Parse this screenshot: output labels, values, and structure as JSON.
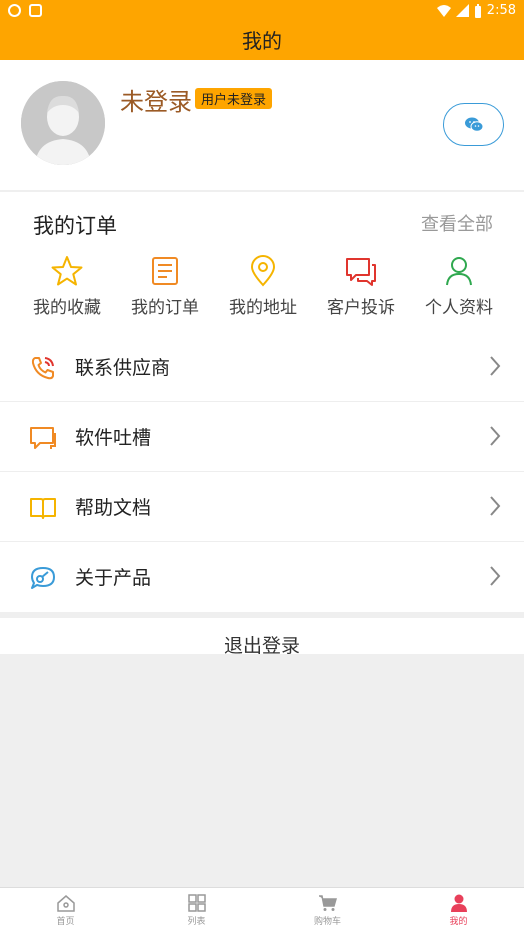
{
  "status_bar": {
    "time": "2:58",
    "icons": [
      "app-icon-1",
      "app-icon-2",
      "wifi-icon",
      "signal-icon",
      "battery-icon"
    ]
  },
  "header": {
    "title": "我的"
  },
  "profile": {
    "username": "未登录",
    "badge": "用户未登录",
    "wechat_icon": "wechat-icon"
  },
  "orders": {
    "title": "我的订单",
    "view_all": "查看全部",
    "items": [
      {
        "label": "我的收藏",
        "icon": "star-icon",
        "color": "#f5b400"
      },
      {
        "label": "我的订单",
        "icon": "order-list-icon",
        "color": "#f08a24"
      },
      {
        "label": "我的地址",
        "icon": "location-pin-icon",
        "color": "#f5b400"
      },
      {
        "label": "客户投诉",
        "icon": "chat-bubbles-icon",
        "color": "#e0352e"
      },
      {
        "label": "个人资料",
        "icon": "user-icon",
        "color": "#2fa84f"
      }
    ]
  },
  "menu": {
    "items": [
      {
        "label": "联系供应商",
        "icon": "phone-icon",
        "color": "#f08a24"
      },
      {
        "label": "软件吐槽",
        "icon": "message-icon",
        "color": "#f08a24"
      },
      {
        "label": "帮助文档",
        "icon": "book-icon",
        "color": "#f5b400"
      },
      {
        "label": "关于产品",
        "icon": "about-icon",
        "color": "#3a9bd8"
      }
    ]
  },
  "logout": {
    "label": "退出登录"
  },
  "tabbar": {
    "items": [
      {
        "label": "首页",
        "icon": "home-icon"
      },
      {
        "label": "列表",
        "icon": "grid-icon"
      },
      {
        "label": "购物车",
        "icon": "cart-icon"
      },
      {
        "label": "我的",
        "icon": "profile-icon",
        "active": true
      }
    ]
  },
  "colors": {
    "primary": "#fea500",
    "active_tab": "#e8405a",
    "link_blue": "#3a9bd8"
  }
}
